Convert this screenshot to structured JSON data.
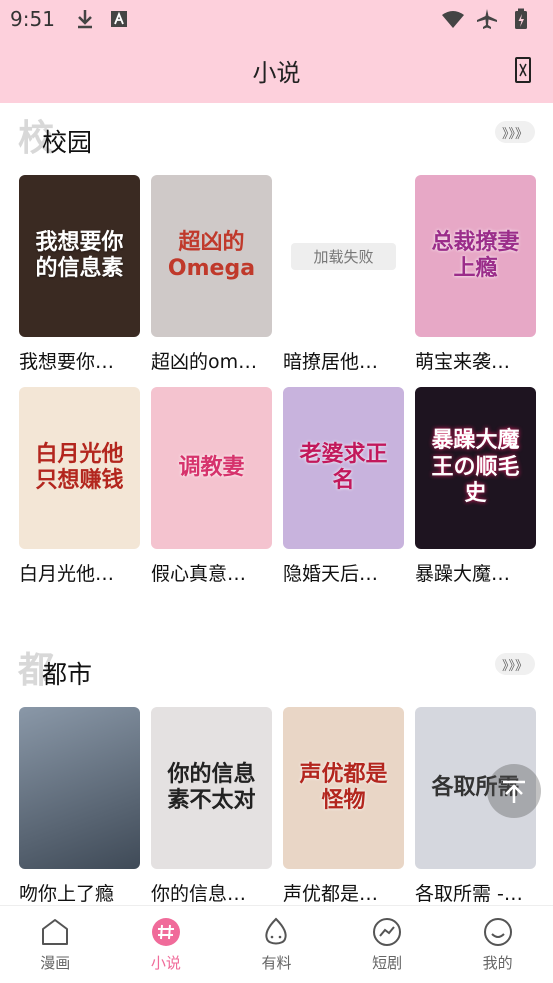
{
  "status_bar": {
    "time": "9:51"
  },
  "header": {
    "title": "小说"
  },
  "sections": [
    {
      "watermark": "校",
      "title": "校园",
      "more": "》》》",
      "books": [
        {
          "name": "我想要你…",
          "cover_text": "我想要你的信息素",
          "cover_color": "#3a2a22"
        },
        {
          "name": "超凶的om…",
          "cover_text": "超凶的Omega",
          "cover_color": "#cfc9c8"
        },
        {
          "name": "暗撩居他…",
          "cover_text": "",
          "cover_color": "#ffffff",
          "failed": "加载失败"
        },
        {
          "name": "萌宝来袭…",
          "cover_text": "总裁撩妻上瘾",
          "cover_color": "#e7a8c6"
        },
        {
          "name": "白月光他…",
          "cover_text": "白月光他只想赚钱",
          "cover_color": "#f3e6d6"
        },
        {
          "name": "假心真意…",
          "cover_text": "调教妻",
          "cover_color": "#f4c3cf"
        },
        {
          "name": "隐婚天后…",
          "cover_text": "老婆求正名",
          "cover_color": "#c8b3dd"
        },
        {
          "name": "暴躁大魔…",
          "cover_text": "暴躁大魔王の顺毛史",
          "cover_color": "#1e1420"
        }
      ]
    },
    {
      "watermark": "都",
      "title": "都市",
      "more": "》》》",
      "books": [
        {
          "name": "吻你上了瘾",
          "cover_text": "",
          "cover_color": "#5b6b7d"
        },
        {
          "name": "你的信息…",
          "cover_text": "你的信息素不太对",
          "cover_color": "#e4e1e1"
        },
        {
          "name": "声优都是…",
          "cover_text": "声优都是怪物",
          "cover_color": "#e9d6c6"
        },
        {
          "name": "各取所需 -…",
          "cover_text": "各取所需",
          "cover_color": "#d5d7de"
        }
      ]
    }
  ],
  "float_button": {
    "label": "top"
  },
  "bottom_nav": [
    {
      "label": "漫画",
      "icon": "comic-icon",
      "active": false
    },
    {
      "label": "小说",
      "icon": "hash-icon",
      "active": true
    },
    {
      "label": "有料",
      "icon": "egg-icon",
      "active": false
    },
    {
      "label": "短剧",
      "icon": "trend-icon",
      "active": false
    },
    {
      "label": "我的",
      "icon": "smile-icon",
      "active": false
    }
  ],
  "colors": {
    "header_bg": "#fdd0dc",
    "accent": "#f06b9a"
  }
}
